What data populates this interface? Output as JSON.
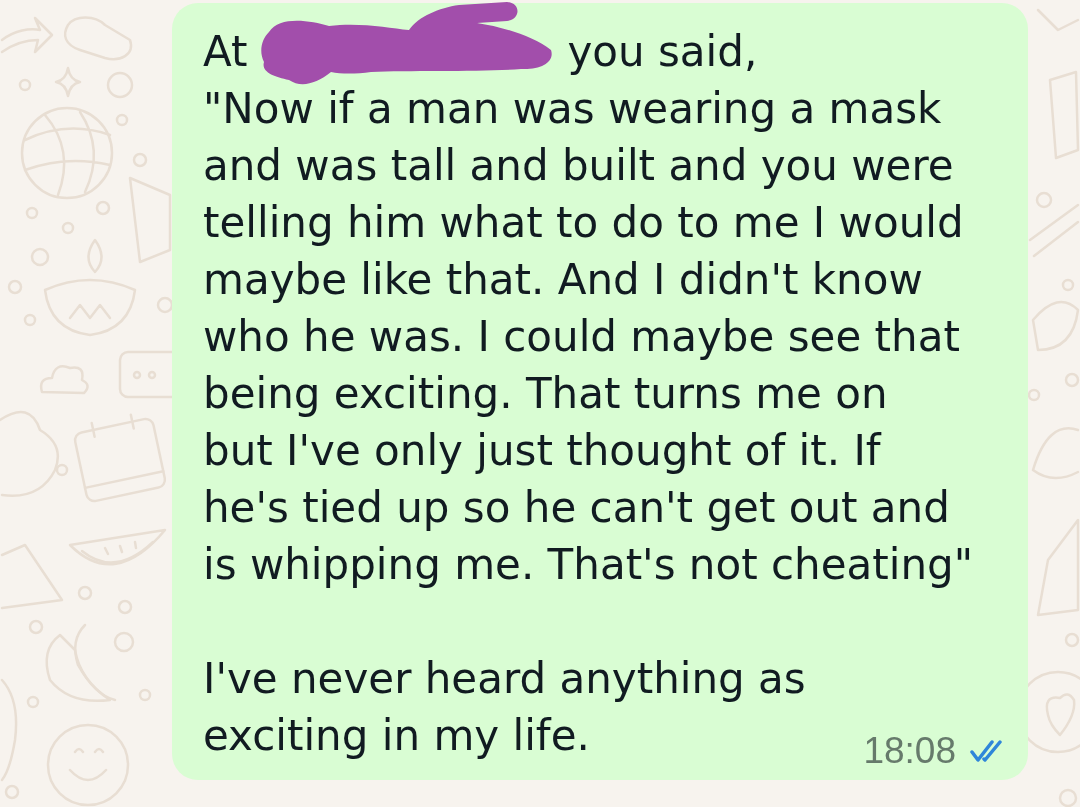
{
  "message": {
    "intro": [
      {
        "kind": "text",
        "text": "At"
      },
      {
        "kind": "redaction"
      },
      {
        "kind": "text",
        "text": "you said,"
      }
    ],
    "paragraphs": [
      "\"Now if a man was wearing a mask\nand was tall and built and you were\ntelling him what to do to me I would\nmaybe like that. And I didn't know\nwho he was. I could maybe see that\nbeing exciting. That turns me on\nbut I've only just thought of it. If\nhe's tied up so he can't get out and\nis whipping me. That's not cheating\"",
      "I've never heard anything as\nexciting in my life."
    ],
    "time": "18:08",
    "read": true
  }
}
